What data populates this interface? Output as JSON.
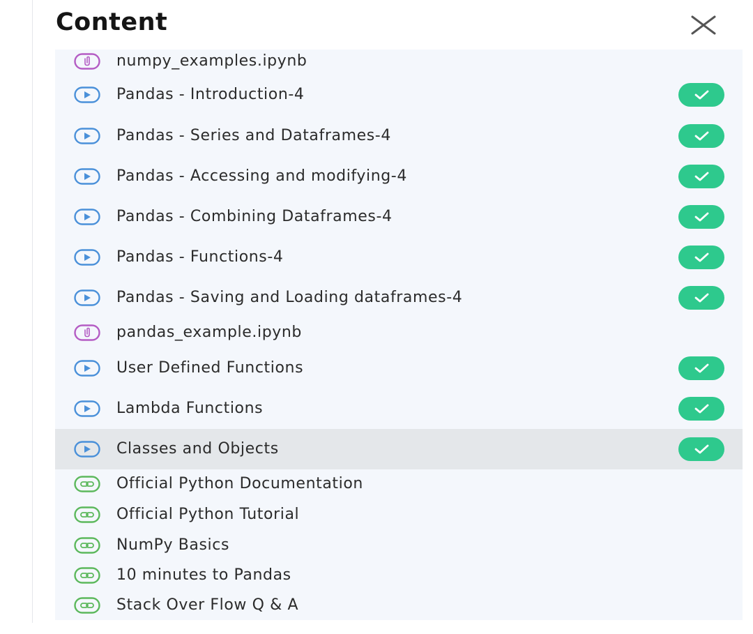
{
  "header": {
    "title": "Content",
    "close_icon": "close-icon"
  },
  "colors": {
    "video_icon": "#4a90d9",
    "file_icon": "#b45cc4",
    "link_icon": "#5cb85c",
    "check_badge": "#2ec98d",
    "active_row": "#e4e7ea"
  },
  "items": [
    {
      "label": "numpy_examples.ipynb",
      "type": "file",
      "completed": false,
      "active": false
    },
    {
      "label": "Pandas - Introduction-4",
      "type": "video",
      "completed": true,
      "active": false
    },
    {
      "label": "Pandas - Series and Dataframes-4",
      "type": "video",
      "completed": true,
      "active": false
    },
    {
      "label": "Pandas - Accessing and modifying-4",
      "type": "video",
      "completed": true,
      "active": false
    },
    {
      "label": "Pandas - Combining Dataframes-4",
      "type": "video",
      "completed": true,
      "active": false
    },
    {
      "label": "Pandas - Functions-4",
      "type": "video",
      "completed": true,
      "active": false
    },
    {
      "label": "Pandas - Saving and Loading dataframes-4",
      "type": "video",
      "completed": true,
      "active": false
    },
    {
      "label": "pandas_example.ipynb",
      "type": "file",
      "completed": false,
      "active": false
    },
    {
      "label": "User Defined Functions",
      "type": "video",
      "completed": true,
      "active": false
    },
    {
      "label": "Lambda Functions",
      "type": "video",
      "completed": true,
      "active": false
    },
    {
      "label": "Classes and Objects",
      "type": "video",
      "completed": true,
      "active": true
    },
    {
      "label": "Official Python Documentation",
      "type": "link",
      "completed": false,
      "active": false
    },
    {
      "label": "Official Python Tutorial",
      "type": "link",
      "completed": false,
      "active": false
    },
    {
      "label": "NumPy Basics",
      "type": "link",
      "completed": false,
      "active": false
    },
    {
      "label": "10 minutes to Pandas",
      "type": "link",
      "completed": false,
      "active": false
    },
    {
      "label": "Stack Over Flow Q & A",
      "type": "link",
      "completed": false,
      "active": false
    }
  ]
}
